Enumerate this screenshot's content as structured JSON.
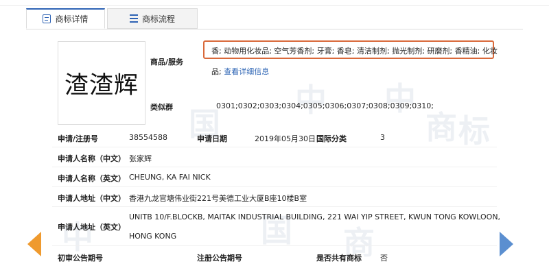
{
  "tabs": {
    "detail": "商标详情",
    "flow": "商标流程"
  },
  "watermark_chars": [
    "中",
    "国",
    "商",
    "标"
  ],
  "mark": {
    "text": "渣渣辉"
  },
  "goods": {
    "label": "商品/服务",
    "line1": "香; 动物用化妆品; 空气芳香剂; 牙膏; 香皂; 清洁制剂; 抛光制剂; 研磨剂; 香精油; 化妆",
    "line2_prefix": "品;",
    "more_link": "查看详细信息"
  },
  "similar": {
    "label": "类似群",
    "value": "0301;0302;0303;0304;0305;0306;0307;0308;0309;0310;"
  },
  "reg_no": {
    "label": "申请/注册号",
    "value": "38554588"
  },
  "app_date": {
    "label": "申请日期",
    "value": "2019年05月30日"
  },
  "intl_class": {
    "label": "国际分类",
    "value": "3"
  },
  "applicant_cn": {
    "label": "申请人名称（中文）",
    "value": "张家辉"
  },
  "applicant_en": {
    "label": "申请人名称（英文）",
    "value": "CHEUNG, KA FAI NICK"
  },
  "address_cn": {
    "label": "申请人地址（中文）",
    "value": "香港九龙官塘伟业街221号美德工业大厦B座10楼B室"
  },
  "address_en": {
    "label": "申请人地址（英文）",
    "line1": "UNITB 10/F.BLOCKB, MAITAK INDUSTRIAL BUILDING, 221 WAI YIP STREET, KWUN TONG KOWLOON,",
    "line2": "HONG KONG"
  },
  "prelim_pub": {
    "label": "初审公告期号",
    "value": ""
  },
  "reg_pub": {
    "label": "注册公告期号",
    "value": ""
  },
  "shared": {
    "label": "是否共有商标",
    "value": "否"
  },
  "colors": {
    "accent": "#2d62b4",
    "highlight": "#d9693a",
    "prev_arrow": "#ef9a2e",
    "next_arrow": "#5b8fd0"
  }
}
